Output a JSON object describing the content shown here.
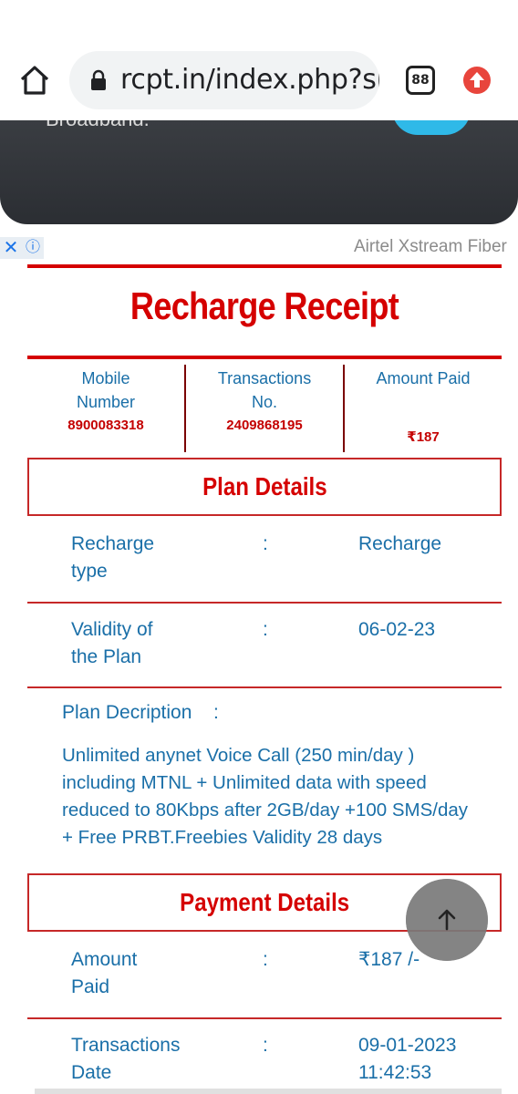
{
  "browser": {
    "url": "rcpt.in/index.php?sho",
    "tab_count": "88"
  },
  "ad": {
    "banner_text": "Broadband.",
    "label": "Airtel Xstream Fiber",
    "close_glyph": "✕",
    "info_glyph": "ⓘ"
  },
  "receipt": {
    "title": "Recharge Receipt",
    "summary": [
      {
        "head_lines": [
          "Mobile",
          "Number"
        ],
        "value": "8900083318"
      },
      {
        "head_lines": [
          "Transactions",
          "No."
        ],
        "value": "2409868195"
      },
      {
        "head_lines": [
          "Amount Paid"
        ],
        "value": "₹187"
      }
    ]
  },
  "plan": {
    "section_title": "Plan Details",
    "rows": [
      {
        "label": "Recharge type",
        "colon": ":",
        "value": "Recharge"
      },
      {
        "label": "Validity of the Plan",
        "colon": ":",
        "value": "06-02-23"
      }
    ],
    "description_label": "Plan Decription",
    "description_colon": ":",
    "description": "Unlimited anynet Voice Call (250 min/day ) including MTNL + Unlimited data with speed reduced to 80Kbps after 2GB/day +100 SMS/day + Free PRBT.Freebies Validity 28 days"
  },
  "payment": {
    "section_title": "Payment Details",
    "rows": [
      {
        "label": "Amount Paid",
        "colon": ":",
        "value": "₹187 /-"
      },
      {
        "label": "Transactions Date",
        "colon": ":",
        "value": "09-01-2023 11:42:53"
      }
    ]
  }
}
